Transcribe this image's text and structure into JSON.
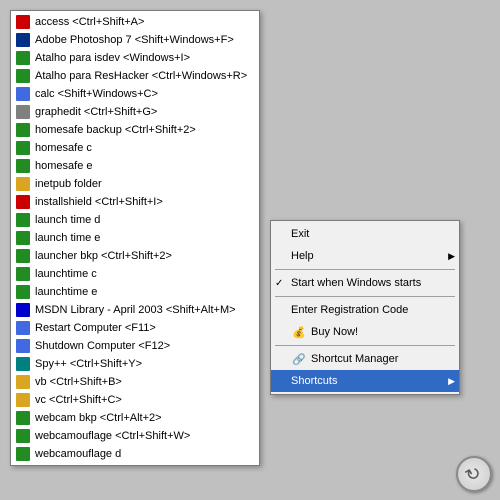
{
  "mainList": {
    "items": [
      {
        "label": "access <Ctrl+Shift+A>",
        "iconColor": "#4169E1",
        "iconChar": "A"
      },
      {
        "label": "Adobe Photoshop 7 <Shift+Windows+F>",
        "iconColor": "#00008B",
        "iconChar": "Ps"
      },
      {
        "label": "Atalho para isdev <Windows+I>",
        "iconColor": "#228B22",
        "iconChar": "►"
      },
      {
        "label": "Atalho para ResHacker <Ctrl+Windows+R>",
        "iconColor": "#228B22",
        "iconChar": "►"
      },
      {
        "label": "calc <Shift+Windows+C>",
        "iconColor": "#4169E1",
        "iconChar": "="
      },
      {
        "label": "graphedit <Ctrl+Shift+G>",
        "iconColor": "#FF8C00",
        "iconChar": "G"
      },
      {
        "label": "homesafe backup <Ctrl+Shift+2>",
        "iconColor": "#228B22",
        "iconChar": "⌂"
      },
      {
        "label": "homesafe c",
        "iconColor": "#228B22",
        "iconChar": "⌂"
      },
      {
        "label": "homesafe e",
        "iconColor": "#228B22",
        "iconChar": "⌂"
      },
      {
        "label": "inetpub folder",
        "iconColor": "#DAA520",
        "iconChar": "📁"
      },
      {
        "label": "installshield <Ctrl+Shift+I>",
        "iconColor": "#CC0000",
        "iconChar": "I"
      },
      {
        "label": "launch time d",
        "iconColor": "#228B22",
        "iconChar": "⏱"
      },
      {
        "label": "launch time e",
        "iconColor": "#228B22",
        "iconChar": "⏱"
      },
      {
        "label": "launcher bkp <Ctrl+Shift+2>",
        "iconColor": "#228B22",
        "iconChar": "►"
      },
      {
        "label": "launchtime c",
        "iconColor": "#228B22",
        "iconChar": "⏱"
      },
      {
        "label": "launchtime e",
        "iconColor": "#228B22",
        "iconChar": "⏱"
      },
      {
        "label": "MSDN Library - April 2003 <Shift+Alt+M>",
        "iconColor": "#0000CD",
        "iconChar": "M"
      },
      {
        "label": "Restart Computer <F11>",
        "iconColor": "#4169E1",
        "iconChar": "↺"
      },
      {
        "label": "Shutdown Computer <F12>",
        "iconColor": "#4169E1",
        "iconChar": "⏻"
      },
      {
        "label": "Spy++ <Ctrl+Shift+Y>",
        "iconColor": "#008080",
        "iconChar": "S"
      },
      {
        "label": "vb <Ctrl+Shift+B>",
        "iconColor": "#DAA520",
        "iconChar": "▶"
      },
      {
        "label": "vc <Ctrl+Shift+C>",
        "iconColor": "#DAA520",
        "iconChar": "▶"
      },
      {
        "label": "webcam bkp <Ctrl+Alt+2>",
        "iconColor": "#228B22",
        "iconChar": "📷"
      },
      {
        "label": "webcamouflage <Ctrl+Shift+W>",
        "iconColor": "#228B22",
        "iconChar": "🎥"
      },
      {
        "label": "webcamouflage d",
        "iconColor": "#228B22",
        "iconChar": "🎥"
      }
    ]
  },
  "contextMenu": {
    "items": [
      {
        "label": "Exit",
        "type": "item",
        "hasArrow": false,
        "checked": false,
        "iconChar": ""
      },
      {
        "label": "Help",
        "type": "item",
        "hasArrow": true,
        "checked": false,
        "iconChar": ""
      },
      {
        "label": "separator1",
        "type": "separator"
      },
      {
        "label": "Start when Windows starts",
        "type": "item",
        "hasArrow": false,
        "checked": true,
        "iconChar": ""
      },
      {
        "label": "separator2",
        "type": "separator"
      },
      {
        "label": "Enter Registration Code",
        "type": "item",
        "hasArrow": false,
        "checked": false,
        "iconChar": ""
      },
      {
        "label": "Buy Now!",
        "type": "item",
        "hasArrow": false,
        "checked": false,
        "iconChar": "💰"
      },
      {
        "label": "separator3",
        "type": "separator"
      },
      {
        "label": "Shortcut Manager",
        "type": "item",
        "hasArrow": false,
        "checked": false,
        "iconChar": "🔗"
      },
      {
        "label": "Shortcuts",
        "type": "item",
        "hasArrow": true,
        "checked": false,
        "highlighted": true,
        "iconChar": ""
      }
    ]
  },
  "refreshButton": {
    "label": "↺"
  }
}
